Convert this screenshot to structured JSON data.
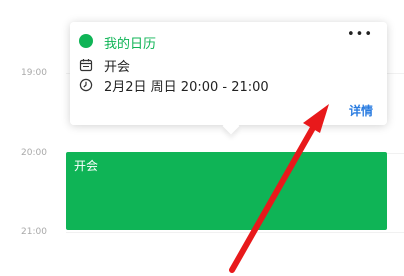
{
  "timeline": {
    "hours": [
      "19:00",
      "20:00",
      "21:00"
    ]
  },
  "event_block": {
    "title": "开会",
    "color": "#0fb456"
  },
  "popup": {
    "calendar_name": "我的日历",
    "calendar_color": "#0fb456",
    "more_label": "•••",
    "event_title": "开会",
    "event_time": "2月2日 周日 20:00 - 21:00",
    "details_label": "详情",
    "link_color": "#2a7ce0"
  },
  "annotation": {
    "arrow_color": "#e8191b",
    "icon": "red-arrow-icon"
  }
}
